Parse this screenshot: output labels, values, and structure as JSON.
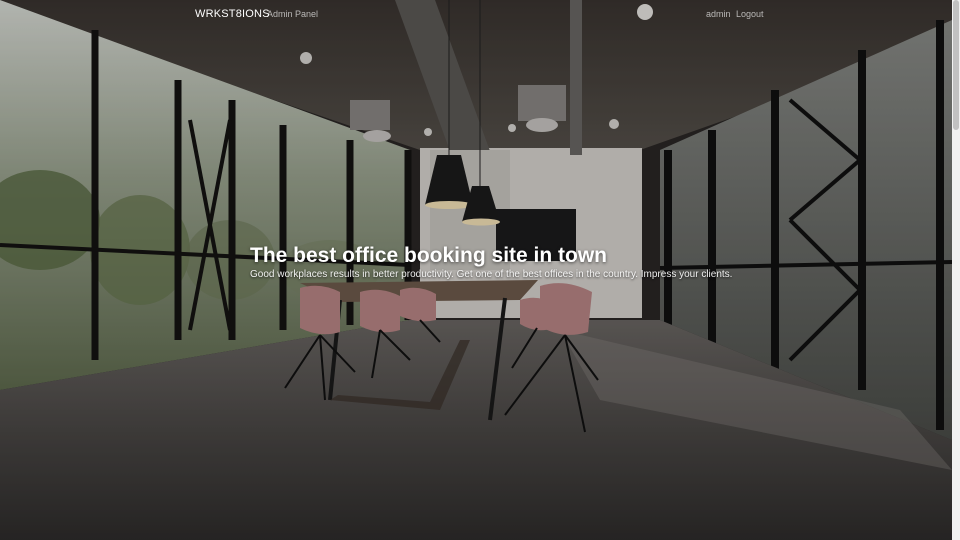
{
  "navbar": {
    "brand": "WRKST8IONS",
    "links": {
      "admin_panel": "Admin Panel",
      "user": "admin",
      "logout": "Logout"
    }
  },
  "hero": {
    "title": "The best office booking site in town",
    "subtitle": "Good workplaces results in better productivity. Get one of the best offices in the country. Impress your clients."
  },
  "background": {
    "subject": "modern office meeting room with long table, pink chairs and pendant lamps"
  },
  "colors": {
    "text": "#ffffff",
    "muted_link": "#a6a6a6"
  }
}
